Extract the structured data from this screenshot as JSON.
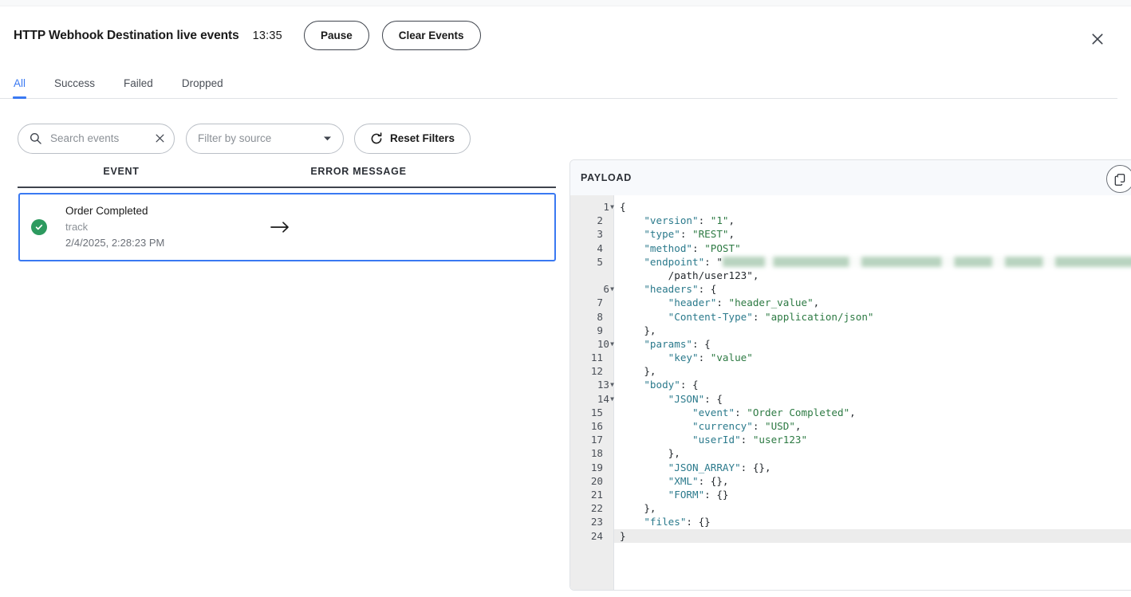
{
  "header": {
    "title": "HTTP Webhook Destination live events",
    "time": "13:35",
    "pause_label": "Pause",
    "clear_label": "Clear Events",
    "close_icon": "close-icon"
  },
  "tabs": [
    {
      "label": "All",
      "active": true
    },
    {
      "label": "Success",
      "active": false
    },
    {
      "label": "Failed",
      "active": false
    },
    {
      "label": "Dropped",
      "active": false
    }
  ],
  "filters": {
    "search_placeholder": "Search events",
    "search_value": "",
    "search_icon": "search-icon",
    "clear_icon": "close-icon",
    "source_selected": "Filter by source",
    "dropdown_icon": "chevron-down-icon",
    "reset_label": "Reset Filters",
    "reset_icon": "refresh-icon"
  },
  "list": {
    "columns": {
      "event": "EVENT",
      "error": "ERROR MESSAGE"
    },
    "rows": [
      {
        "status": "success",
        "status_color": "#2d9a5f",
        "name": "Order Completed",
        "type": "track",
        "timestamp": "2/4/2025, 2:28:23 PM",
        "error": "",
        "arrow_icon": "arrow-right-icon",
        "selected": true
      }
    ]
  },
  "payload": {
    "title": "PAYLOAD",
    "copy_icon": "copy-icon",
    "active_line": 24,
    "lines": [
      {
        "n": 1,
        "fold": true,
        "text": "{"
      },
      {
        "n": 2,
        "fold": false,
        "text": "    \"version\": \"1\","
      },
      {
        "n": 3,
        "fold": false,
        "text": "    \"type\": \"REST\","
      },
      {
        "n": 4,
        "fold": false,
        "text": "    \"method\": \"POST\""
      },
      {
        "n": 5,
        "fold": false,
        "text": "    \"endpoint\": \"[redacted]"
      },
      {
        "n": null,
        "fold": false,
        "text": "        /path/user123\","
      },
      {
        "n": 6,
        "fold": true,
        "text": "    \"headers\": {"
      },
      {
        "n": 7,
        "fold": false,
        "text": "        \"header\": \"header_value\","
      },
      {
        "n": 8,
        "fold": false,
        "text": "        \"Content-Type\": \"application/json\""
      },
      {
        "n": 9,
        "fold": false,
        "text": "    },"
      },
      {
        "n": 10,
        "fold": true,
        "text": "    \"params\": {"
      },
      {
        "n": 11,
        "fold": false,
        "text": "        \"key\": \"value\""
      },
      {
        "n": 12,
        "fold": false,
        "text": "    },"
      },
      {
        "n": 13,
        "fold": true,
        "text": "    \"body\": {"
      },
      {
        "n": 14,
        "fold": true,
        "text": "        \"JSON\": {"
      },
      {
        "n": 15,
        "fold": false,
        "text": "            \"event\": \"Order Completed\","
      },
      {
        "n": 16,
        "fold": false,
        "text": "            \"currency\": \"USD\","
      },
      {
        "n": 17,
        "fold": false,
        "text": "            \"userId\": \"user123\""
      },
      {
        "n": 18,
        "fold": false,
        "text": "        },"
      },
      {
        "n": 19,
        "fold": false,
        "text": "        \"JSON_ARRAY\": {},"
      },
      {
        "n": 20,
        "fold": false,
        "text": "        \"XML\": {},"
      },
      {
        "n": 21,
        "fold": false,
        "text": "        \"FORM\": {}"
      },
      {
        "n": 22,
        "fold": false,
        "text": "    },"
      },
      {
        "n": 23,
        "fold": false,
        "text": "    \"files\": {}"
      },
      {
        "n": 24,
        "fold": false,
        "text": "}"
      }
    ]
  },
  "colors": {
    "accent": "#3a79f2",
    "success": "#2d9a5f",
    "json_key": "#2b7a8c",
    "json_string": "#2d7a43",
    "border": "#dfe2e6"
  }
}
